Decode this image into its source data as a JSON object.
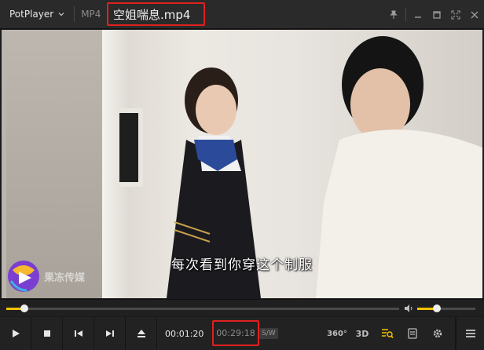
{
  "titlebar": {
    "app_name": "PotPlayer",
    "format": "MP4",
    "file_title": "空姐喘息.mp4"
  },
  "video": {
    "subtitle": "每次看到你穿这个制服",
    "watermark": "果冻传媒"
  },
  "seek": {
    "progress_fraction": 0.046,
    "volume_fraction": 0.34
  },
  "controls": {
    "current_time": "00:01:20",
    "total_time": "00:29:18",
    "sw_label": "S/W",
    "btn_360": "360°",
    "btn_3d": "3D"
  },
  "colors": {
    "accent": "#f2c200",
    "highlight_border": "#e02020"
  }
}
